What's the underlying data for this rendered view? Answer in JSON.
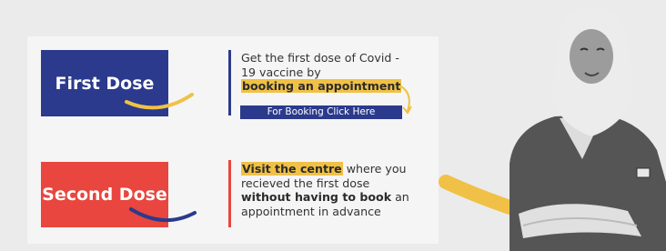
{
  "first_dose": {
    "label": "First Dose",
    "text_before": "Get the first dose of Covid - 19 vaccine by",
    "text_highlight": "booking an appointment",
    "button_label": "For Booking Click Here"
  },
  "second_dose": {
    "label": "Second Dose",
    "text_highlight": "Visit the centre",
    "text_mid": " where you recieved the first dose ",
    "text_bold": "without having to book",
    "text_after": " an appointment in advance"
  },
  "colors": {
    "navy": "#2b3a8c",
    "red": "#e8463e",
    "yellow": "#f0c146",
    "panel": "#f5f5f5",
    "background": "#ebebeb"
  },
  "icons": [
    "swoosh-yellow",
    "swoosh-navy",
    "arrow-curve-icon",
    "flag-badge-icon"
  ]
}
